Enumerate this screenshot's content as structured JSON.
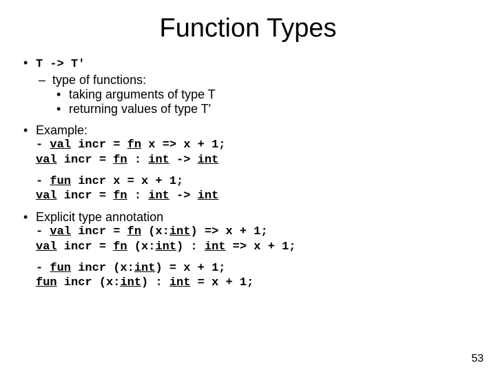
{
  "title": "Function Types",
  "b1": {
    "head": "T -> T'",
    "sub": "type of functions:",
    "a": "taking arguments of type T",
    "b": "returning values of type T'"
  },
  "b2": {
    "head": "Example:",
    "code1a_pre": "- ",
    "code1a_val": "val",
    "code1a_mid": " incr = ",
    "code1a_fn": "fn",
    "code1a_post": " x => x + 1;",
    "code1b_pad": "  ",
    "code1b_val": "val",
    "code1b_mid": " incr = ",
    "code1b_fn": "fn",
    "code1b_c1": " : ",
    "code1b_int1": "int",
    "code1b_c2": " -> ",
    "code1b_int2": "int",
    "code2a_pre": "- ",
    "code2a_fun": "fun",
    "code2a_post": " incr x = x + 1;",
    "code2b_pad": "  ",
    "code2b_val": "val",
    "code2b_mid": " incr = ",
    "code2b_fn": "fn",
    "code2b_c1": " : ",
    "code2b_int1": "int",
    "code2b_c2": " -> ",
    "code2b_int2": "int"
  },
  "b3": {
    "head": "Explicit type annotation",
    "code1a_pre": "- ",
    "code1a_val": "val",
    "code1a_mid": " incr = ",
    "code1a_fn": "fn",
    "code1a_p1": " (x:",
    "code1a_int": "int",
    "code1a_post": ") => x + 1;",
    "code1b_pad": "  ",
    "code1b_val": "val",
    "code1b_mid": " incr = ",
    "code1b_fn": "fn",
    "code1b_p1": " (x:",
    "code1b_int1": "int",
    "code1b_p2": ") : ",
    "code1b_int2": "int",
    "code1b_post": " => x + 1;",
    "code2a_pre": "- ",
    "code2a_fun": "fun",
    "code2a_p1": " incr (x:",
    "code2a_int": "int",
    "code2a_post": ") = x + 1;",
    "code2b_pad": "  ",
    "code2b_fun": "fun",
    "code2b_p1": " incr (x:",
    "code2b_int1": "int",
    "code2b_p2": ") : ",
    "code2b_int2": "int",
    "code2b_post": " = x + 1;"
  },
  "page": "53"
}
